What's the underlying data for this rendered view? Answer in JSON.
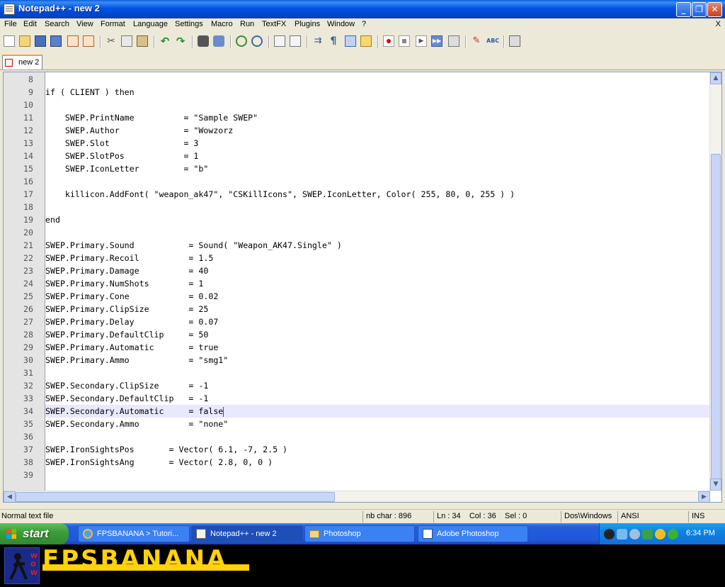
{
  "window": {
    "title": "Notepad++ - new 2",
    "controls": [
      "minimize",
      "maximize",
      "close"
    ]
  },
  "menu": {
    "items": [
      "File",
      "Edit",
      "Search",
      "View",
      "Format",
      "Language",
      "Settings",
      "Macro",
      "Run",
      "TextFX",
      "Plugins",
      "Window",
      "?"
    ],
    "close_label": "X"
  },
  "toolbar": {
    "icons": [
      "new-file-icon",
      "open-file-icon",
      "save-icon",
      "save-all-icon",
      "close-icon",
      "close-all-icon",
      "cut-icon",
      "copy-icon",
      "paste-icon",
      "undo-icon",
      "redo-icon",
      "find-icon",
      "replace-icon",
      "zoom-in-icon",
      "zoom-out-icon",
      "sync-vertical-icon",
      "sync-horizontal-icon",
      "word-wrap-icon",
      "show-all-chars-icon",
      "indent-guide-icon",
      "user-lang-icon",
      "record-macro-icon",
      "stop-macro-icon",
      "play-macro-icon",
      "run-macro-multiple-icon",
      "save-macro-icon",
      "trim-icon",
      "spellcheck-icon",
      "print-icon"
    ]
  },
  "tabs": [
    {
      "label": "new 2",
      "active": true
    }
  ],
  "editor": {
    "lines": [
      {
        "n": "8",
        "text": ""
      },
      {
        "n": "9",
        "text": "if ( CLIENT ) then"
      },
      {
        "n": "10",
        "text": ""
      },
      {
        "n": "11",
        "text": "    SWEP.PrintName          = \"Sample SWEP\""
      },
      {
        "n": "12",
        "text": "    SWEP.Author             = \"Wowzorz"
      },
      {
        "n": "13",
        "text": "    SWEP.Slot               = 3"
      },
      {
        "n": "14",
        "text": "    SWEP.SlotPos            = 1"
      },
      {
        "n": "15",
        "text": "    SWEP.IconLetter         = \"b\""
      },
      {
        "n": "16",
        "text": ""
      },
      {
        "n": "17",
        "text": "    killicon.AddFont( \"weapon_ak47\", \"CSKillIcons\", SWEP.IconLetter, Color( 255, 80, 0, 255 ) )"
      },
      {
        "n": "18",
        "text": ""
      },
      {
        "n": "19",
        "text": "end"
      },
      {
        "n": "20",
        "text": ""
      },
      {
        "n": "21",
        "text": "SWEP.Primary.Sound           = Sound( \"Weapon_AK47.Single\" )"
      },
      {
        "n": "22",
        "text": "SWEP.Primary.Recoil          = 1.5"
      },
      {
        "n": "23",
        "text": "SWEP.Primary.Damage          = 40"
      },
      {
        "n": "24",
        "text": "SWEP.Primary.NumShots        = 1"
      },
      {
        "n": "25",
        "text": "SWEP.Primary.Cone            = 0.02"
      },
      {
        "n": "26",
        "text": "SWEP.Primary.ClipSize        = 25"
      },
      {
        "n": "27",
        "text": "SWEP.Primary.Delay           = 0.07"
      },
      {
        "n": "28",
        "text": "SWEP.Primary.DefaultClip     = 50"
      },
      {
        "n": "29",
        "text": "SWEP.Primary.Automatic       = true"
      },
      {
        "n": "30",
        "text": "SWEP.Primary.Ammo            = \"smg1\""
      },
      {
        "n": "31",
        "text": ""
      },
      {
        "n": "32",
        "text": "SWEP.Secondary.ClipSize      = -1"
      },
      {
        "n": "33",
        "text": "SWEP.Secondary.DefaultClip   = -1"
      },
      {
        "n": "34",
        "text": "SWEP.Secondary.Automatic     = false",
        "current": true
      },
      {
        "n": "35",
        "text": "SWEP.Secondary.Ammo          = \"none\""
      },
      {
        "n": "36",
        "text": ""
      },
      {
        "n": "37",
        "text": "SWEP.IronSightsPos       = Vector( 6.1, -7, 2.5 )"
      },
      {
        "n": "38",
        "text": "SWEP.IronSightsAng       = Vector( 2.8, 0, 0 )"
      },
      {
        "n": "39",
        "text": ""
      }
    ]
  },
  "status": {
    "file_type": "Normal text file",
    "nb_char": "nb char : 896",
    "position": "Ln : 34    Col : 36    Sel : 0",
    "eol": "Dos\\Windows",
    "encoding": "ANSI",
    "mode": "INS"
  },
  "taskbar": {
    "start_label": "start",
    "tasks": [
      {
        "label": "FPSBANANA > Tutori...",
        "icon": "ie-icon",
        "active": false
      },
      {
        "label": "Notepad++ - new 2",
        "icon": "notepad-icon",
        "active": true
      },
      {
        "label": "Photoshop",
        "icon": "folder-icon",
        "active": false
      },
      {
        "label": "Adobe Photoshop",
        "icon": "photoshop-icon",
        "active": false
      }
    ],
    "tray_icons": [
      "steam-icon",
      "network-icon",
      "volume-icon",
      "tray-app-icon",
      "messenger-icon",
      "update-icon"
    ],
    "clock": "6:34 PM"
  },
  "banner": {
    "brand": "FPSBANANA",
    "logo_text": "WOW",
    "colors": {
      "brand": "#ffd20a",
      "background": "#000000"
    }
  },
  "colors": {
    "titlebar": "#0054e3",
    "current_line": "#e8e8ff",
    "caret": "#e0007a",
    "tab_accent": "#fa9e2a"
  }
}
